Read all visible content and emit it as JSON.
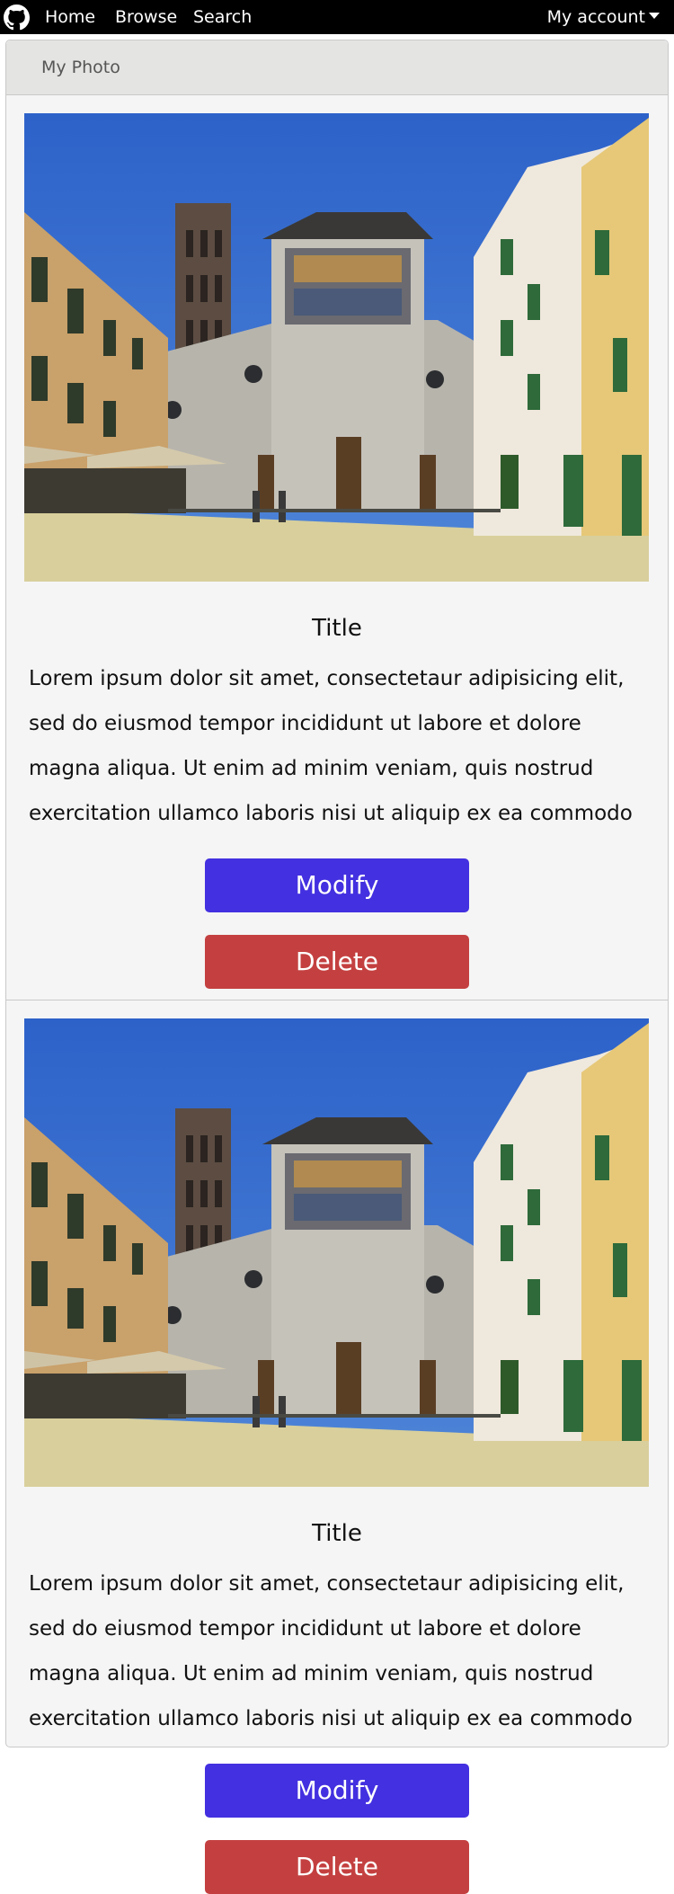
{
  "nav": {
    "home": "Home",
    "browse": "Browse",
    "search": "Search",
    "account": "My account"
  },
  "panel": {
    "title": "My Photo"
  },
  "photos": [
    {
      "title": "Title",
      "description": "Lorem ipsum dolor sit amet, consectetaur adipisicing elit, sed do eiusmod tempor incididunt ut labore et dolore magna aliqua. Ut enim ad minim veniam, quis nostrud exercitation ullamco laboris nisi ut aliquip ex ea commodo consequat....",
      "modify_label": "Modify",
      "delete_label": "Delete"
    },
    {
      "title": "Title",
      "description": "Lorem ipsum dolor sit amet, consectetaur adipisicing elit, sed do eiusmod tempor incididunt ut labore et dolore magna aliqua. Ut enim ad minim veniam, quis nostrud exercitation ullamco laboris nisi ut aliquip ex ea commodo consequat....",
      "modify_label": "Modify",
      "delete_label": "Delete"
    }
  ],
  "colors": {
    "navbar": "#000000",
    "modify_button": "#4330e0",
    "delete_button": "#c44040",
    "panel_bg": "#f5f5f5",
    "panel_header_bg": "#e4e4e2"
  }
}
